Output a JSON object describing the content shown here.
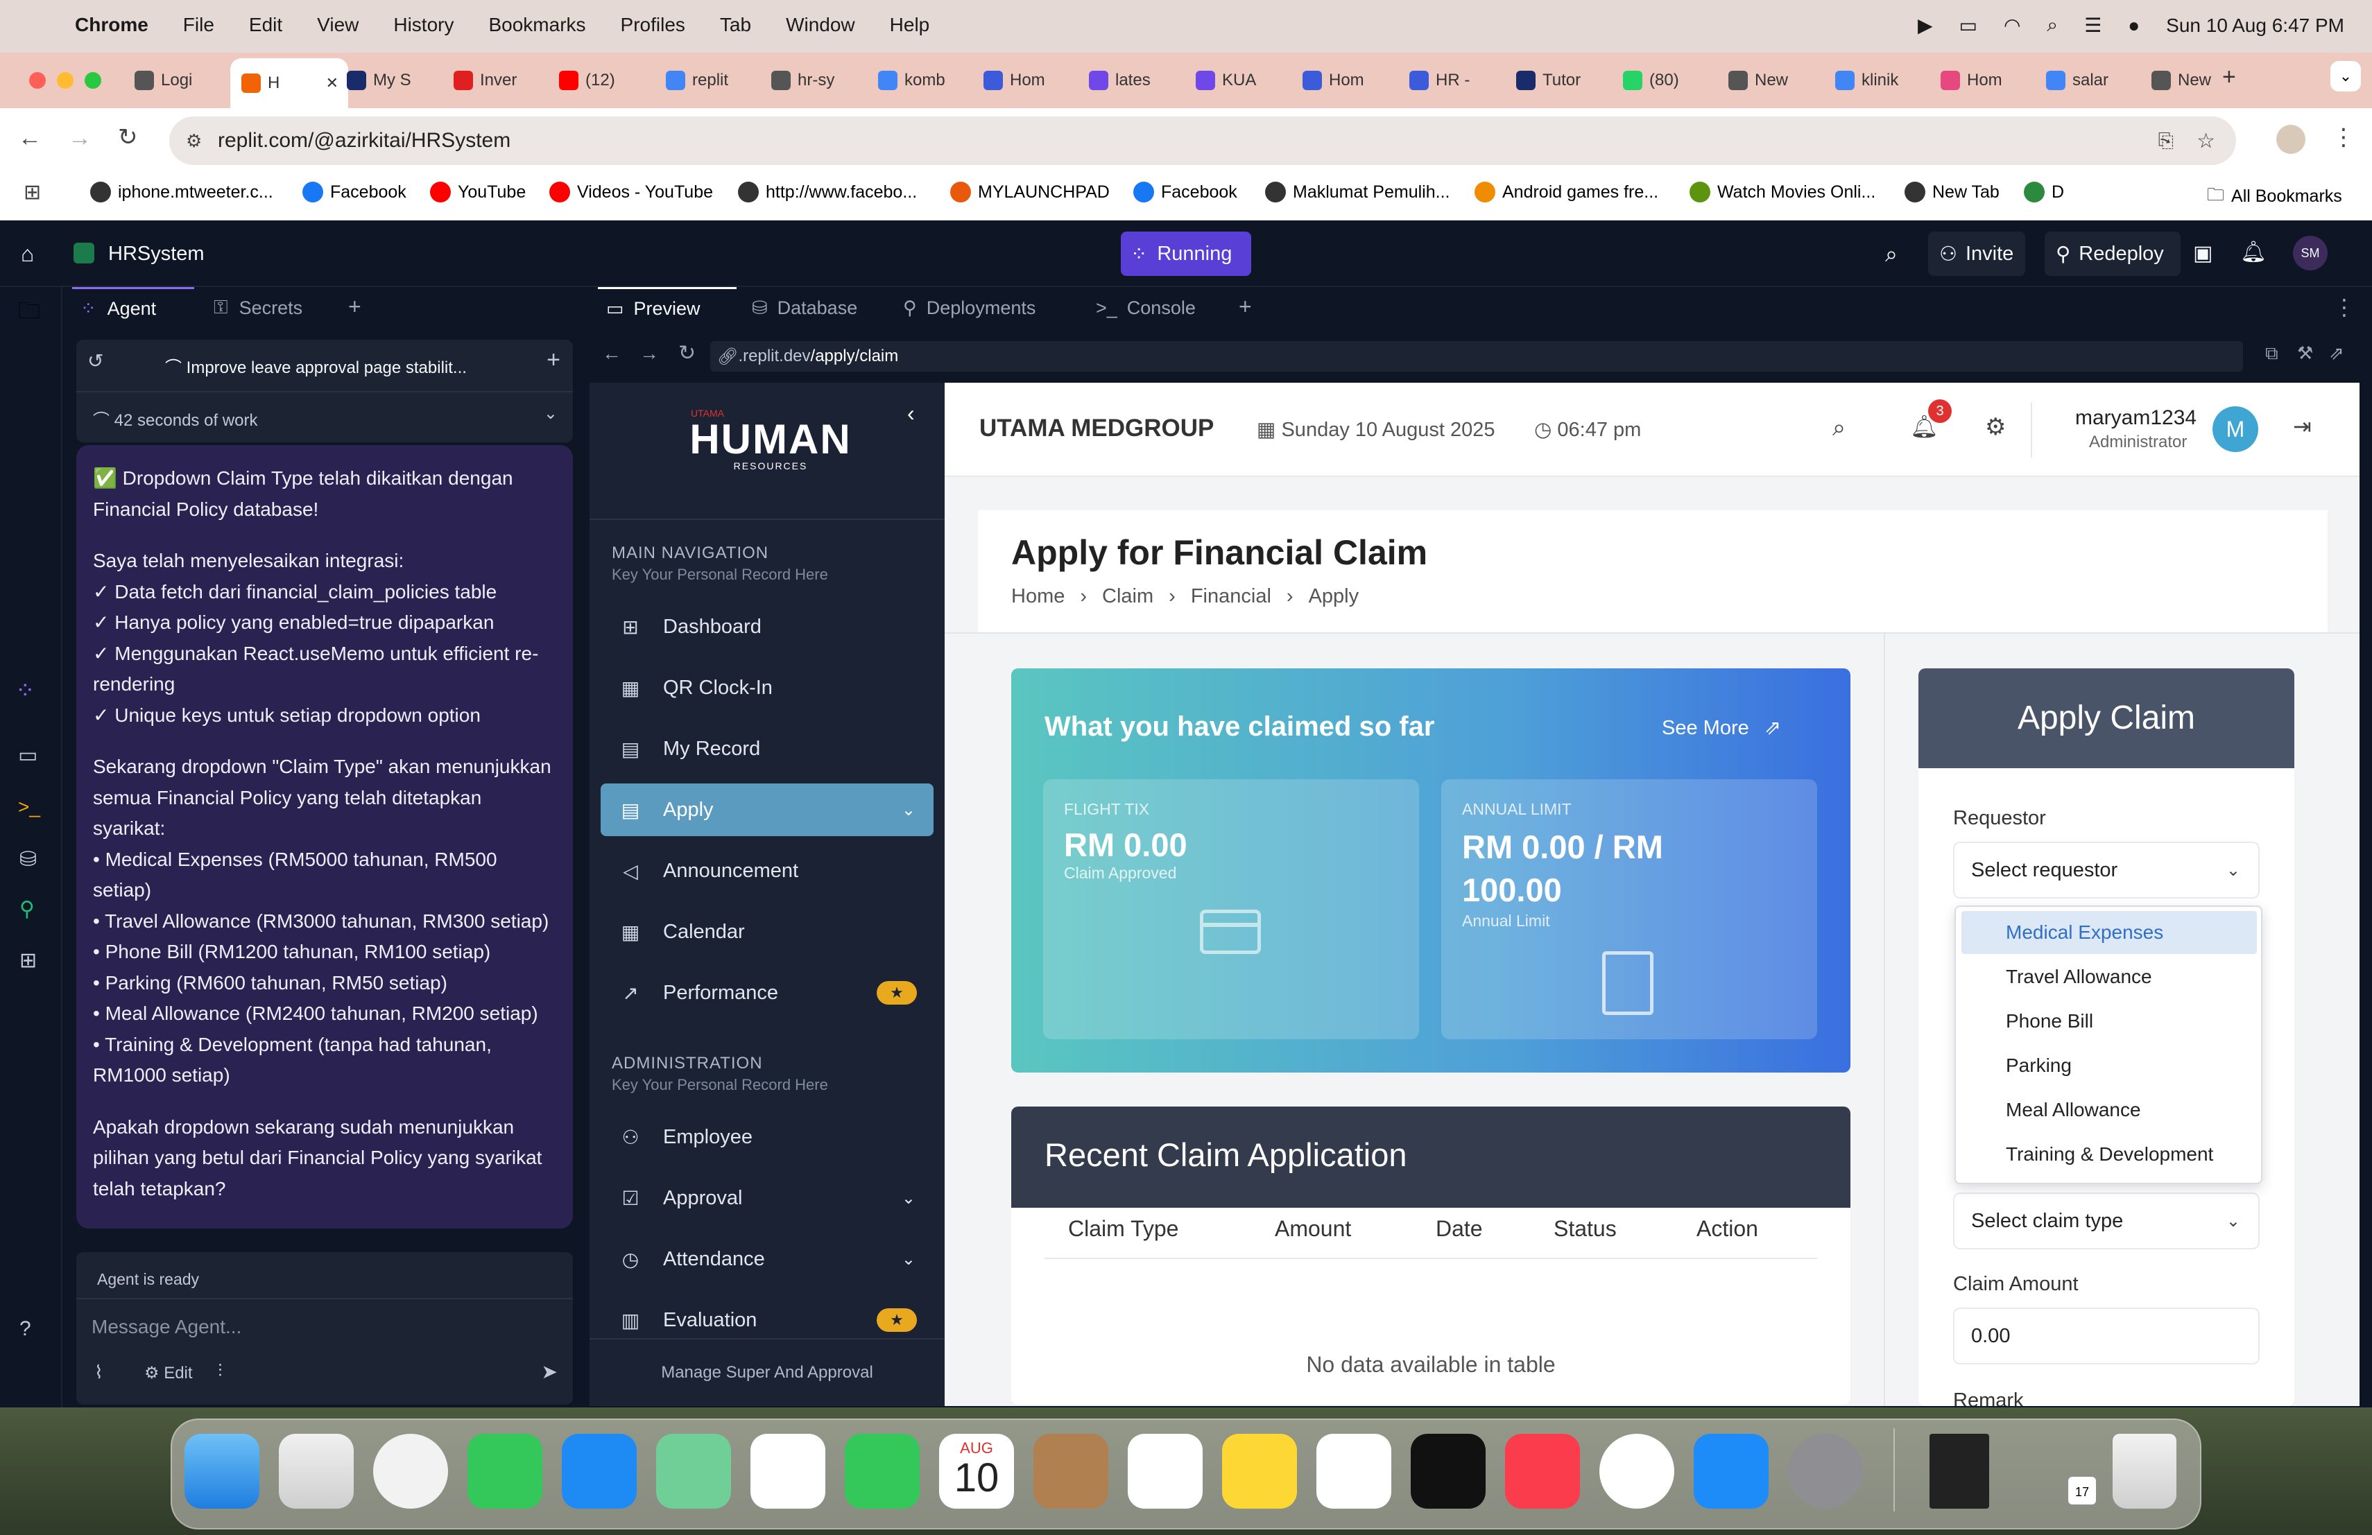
{
  "mac_menubar": {
    "app": "Chrome",
    "items": [
      "File",
      "Edit",
      "View",
      "History",
      "Bookmarks",
      "Profiles",
      "Tab",
      "Window",
      "Help"
    ],
    "clock": "Sun 10 Aug  6:47 PM"
  },
  "browser": {
    "tabs": [
      {
        "label": "Logi",
        "fav": "#555"
      },
      {
        "label": "H",
        "fav": "#f26207",
        "active": true
      },
      {
        "label": "My S",
        "fav": "#1a2b6b"
      },
      {
        "label": "Inver",
        "fav": "#e02020"
      },
      {
        "label": "(12)",
        "fav": "#ff0000"
      },
      {
        "label": "replit",
        "fav": "#4285f4"
      },
      {
        "label": "hr-sy",
        "fav": "#555"
      },
      {
        "label": "komb",
        "fav": "#4285f4"
      },
      {
        "label": "Hom",
        "fav": "#3b5bdb"
      },
      {
        "label": "lates",
        "fav": "#7048e8"
      },
      {
        "label": "KUA",
        "fav": "#7048e8"
      },
      {
        "label": "Hom",
        "fav": "#3b5bdb"
      },
      {
        "label": "HR -",
        "fav": "#3b5bdb"
      },
      {
        "label": "Tutor",
        "fav": "#1a2b6b"
      },
      {
        "label": "(80)",
        "fav": "#25d366"
      },
      {
        "label": "New",
        "fav": "#555"
      },
      {
        "label": "klinik",
        "fav": "#4285f4"
      },
      {
        "label": "Hom",
        "fav": "#e64980"
      },
      {
        "label": "salar",
        "fav": "#4285f4"
      },
      {
        "label": "New",
        "fav": "#555"
      }
    ],
    "url": "replit.com/@azirkitai/HRSystem",
    "bookmarks": [
      {
        "label": "iphone.mtweeter.c...",
        "color": "#333"
      },
      {
        "label": "Facebook",
        "color": "#1877f2"
      },
      {
        "label": "YouTube",
        "color": "#ff0000"
      },
      {
        "label": "Videos - YouTube",
        "color": "#ff0000"
      },
      {
        "label": "http://www.facebo...",
        "color": "#333"
      },
      {
        "label": "MYLAUNCHPAD",
        "color": "#e8590c"
      },
      {
        "label": "Facebook",
        "color": "#1877f2"
      },
      {
        "label": "Maklumat Pemulih...",
        "color": "#333"
      },
      {
        "label": "Android games fre...",
        "color": "#f08c00"
      },
      {
        "label": "Watch Movies Onli...",
        "color": "#5c940d"
      },
      {
        "label": "New Tab",
        "color": "#333"
      },
      {
        "label": "D",
        "color": "#2b8a3e"
      }
    ],
    "all_bookmarks": "All Bookmarks"
  },
  "replit": {
    "project": "HRSystem",
    "status": "Running",
    "invite": "Invite",
    "redeploy": "Redeploy",
    "avatar": "SM",
    "left_tabs": [
      "Agent",
      "Secrets"
    ],
    "thread_title": "Improve leave approval page stabilit...",
    "work_time": "42 seconds of work",
    "agent_message": [
      "✅ Dropdown Claim Type telah dikaitkan dengan Financial Policy database!",
      "Saya telah menyelesaikan integrasi:\n✓ Data fetch dari financial_claim_policies table\n✓ Hanya policy yang enabled=true dipaparkan\n✓ Menggunakan React.useMemo untuk efficient re-rendering\n✓ Unique keys untuk setiap dropdown option",
      "Sekarang dropdown \"Claim Type\" akan menunjukkan semua Financial Policy yang telah ditetapkan syarikat:\n• Medical Expenses (RM5000 tahunan, RM500 setiap)\n• Travel Allowance (RM3000 tahunan, RM300 setiap)\n• Phone Bill (RM1200 tahunan, RM100 setiap)\n• Parking (RM600 tahunan, RM50 setiap)\n• Meal Allowance (RM2400 tahunan, RM200 setiap)\n• Training & Development (tanpa had tahunan, RM1000 setiap)",
      "Apakah dropdown sekarang sudah menunjukkan pilihan yang betul dari Financial Policy yang syarikat telah tetapkan?"
    ],
    "agent_status": "Agent is ready",
    "message_placeholder": "Message Agent...",
    "edit_label": "Edit",
    "preview_tabs": [
      "Preview",
      "Database",
      "Deployments",
      "Console"
    ],
    "preview_url_prefix": ".replit.dev",
    "preview_url_path": "/apply/claim"
  },
  "hr": {
    "logo_top": "UTAMA",
    "logo_main": "HUMAN",
    "logo_sub": "RESOURCES",
    "company": "UTAMA MEDGROUP",
    "date": "Sunday 10 August 2025",
    "time": "06:47 pm",
    "notif_count": "3",
    "user": "maryam1234",
    "role": "Administrator",
    "user_initial": "M",
    "nav_header": "MAIN NAVIGATION",
    "nav_sub": "Key Your Personal Record Here",
    "nav": [
      "Dashboard",
      "QR Clock-In",
      "My Record",
      "Apply",
      "Announcement",
      "Calendar",
      "Performance"
    ],
    "admin_header": "ADMINISTRATION",
    "admin_sub": "Key Your Personal Record Here",
    "admin_nav": [
      "Employee",
      "Approval",
      "Attendance",
      "Evaluation"
    ],
    "sidebar_footer": "Manage Super And Approval",
    "page_title": "Apply for Financial Claim",
    "breadcrumb": [
      "Home",
      "Claim",
      "Financial",
      "Apply"
    ],
    "claimed_title": "What you have claimed so far",
    "see_more": "See More",
    "card1_label": "FLIGHT TIX",
    "card1_value": "RM 0.00",
    "card1_sub": "Claim Approved",
    "card2_label": "ANNUAL LIMIT",
    "card2_value": "RM 0.00 / RM 100.00",
    "card2_sub": "Annual Limit",
    "recent_title": "Recent Claim Application",
    "table_headers": [
      "Claim Type",
      "Amount",
      "Date",
      "Status",
      "Action"
    ],
    "no_data": "No data available in table",
    "apply_title": "Apply Claim",
    "requestor_label": "Requestor",
    "requestor_placeholder": "Select requestor",
    "claim_type_placeholder": "Select claim type",
    "claim_options": [
      "Medical Expenses",
      "Travel Allowance",
      "Phone Bill",
      "Parking",
      "Meal Allowance",
      "Training & Development"
    ],
    "amount_label": "Claim Amount",
    "amount_value": "0.00",
    "remark_label": "Remark"
  },
  "dock": {
    "calendar_month": "AUG",
    "calendar_day": "10",
    "mini_cal_day": "17"
  }
}
